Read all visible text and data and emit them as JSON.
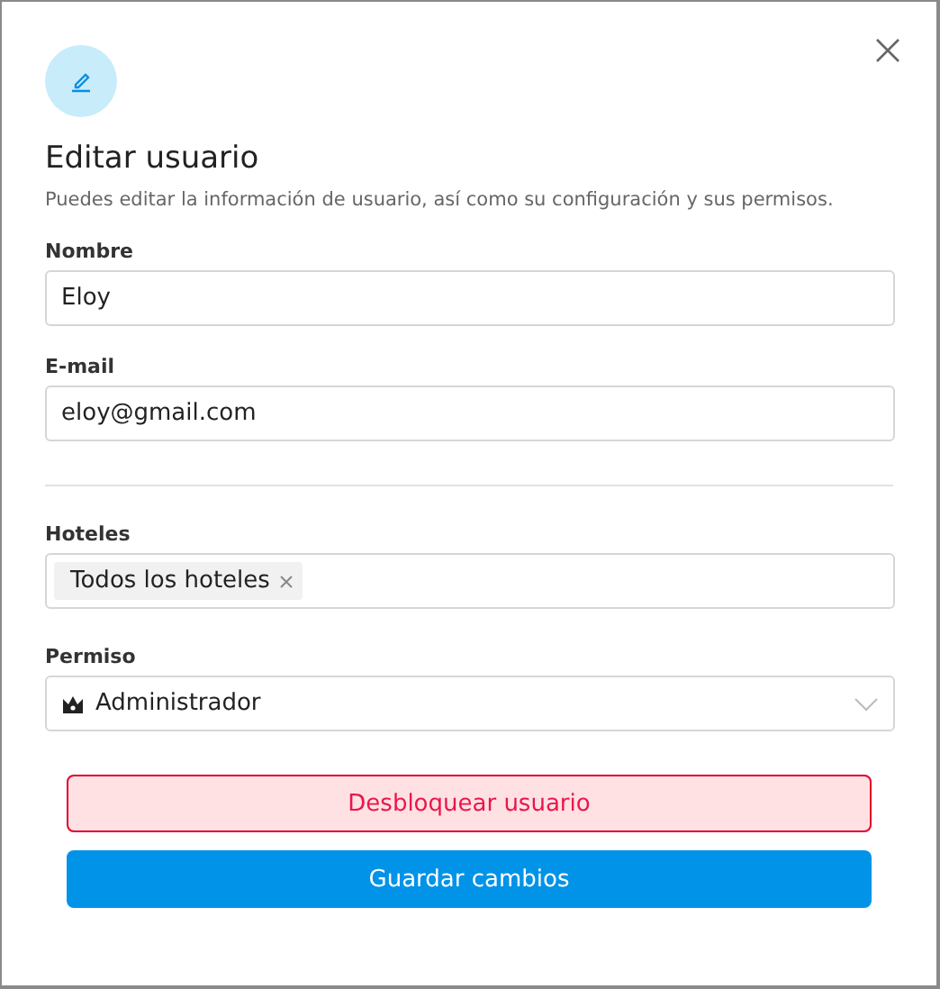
{
  "dialog": {
    "title": "Editar usuario",
    "subtitle": "Puedes editar la información de usuario, así como su configuración y sus permisos."
  },
  "fields": [
    {
      "label": "Nombre",
      "value": "Eloy"
    },
    {
      "label": "E-mail",
      "value": "eloy@gmail.com"
    }
  ],
  "hotels": {
    "label": "Hoteles",
    "tags": [
      "Todos los hoteles"
    ]
  },
  "permission": {
    "label": "Permiso",
    "value": "Administrador"
  },
  "buttons": [
    {
      "label": "Desbloquear usuario",
      "kind": "danger"
    },
    {
      "label": "Guardar cambios",
      "kind": "primary"
    }
  ]
}
